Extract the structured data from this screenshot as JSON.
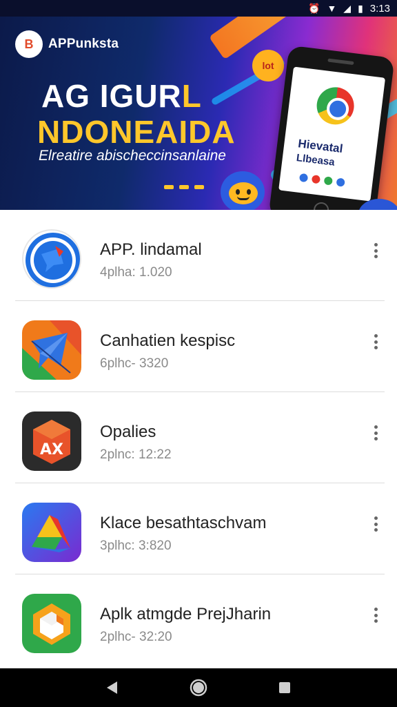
{
  "status_bar": {
    "time": "3:13",
    "icons": [
      "alarm-icon",
      "wifi-icon",
      "signal-icon",
      "battery-icon"
    ]
  },
  "banner": {
    "brand_name": "APPunksta",
    "brand_logo_letters": "B",
    "headline_line1_white": "AG IGUR",
    "headline_line1_accent": "L",
    "headline_line2": "NDONEAIDA",
    "tagline": "Elreatire abischeccinsanlaine",
    "phone_title": "Hievatal",
    "phone_subtitle": "Llbeasa",
    "coin_text": "lot"
  },
  "apps": [
    {
      "title": "APP. lindamal",
      "subtitle": "4plha: 1.020",
      "icon": "chat-bubble-icon"
    },
    {
      "title": "Canhatien kespisc",
      "subtitle": "6plhc- 3320",
      "icon": "paper-plane-icon"
    },
    {
      "title": "Opalies",
      "subtitle": "2plnc: 12:22",
      "icon": "ax-box-icon"
    },
    {
      "title": "Klace besathtaschvam",
      "subtitle": "3plhc: 3:820",
      "icon": "drive-triangle-icon"
    },
    {
      "title": "Aplk atmgde PrejJharin",
      "subtitle": "2plhc- 32:20",
      "icon": "cube-icon"
    }
  ],
  "colors": {
    "accent_yellow": "#ffc72b",
    "banner_dark": "#0c1a4a",
    "divider": "#dcdcdc",
    "subtitle_gray": "#8a8a8a"
  }
}
